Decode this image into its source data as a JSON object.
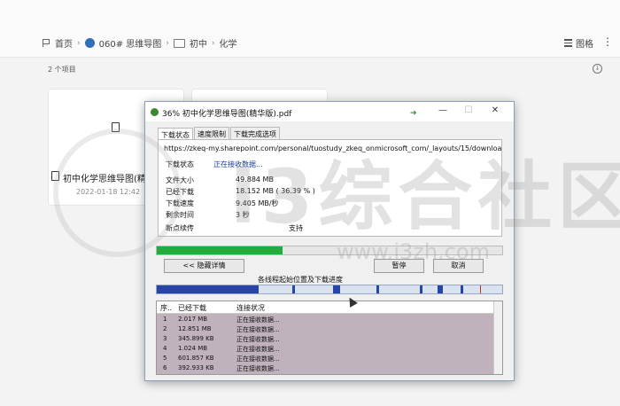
{
  "breadcrumb": {
    "home": "首页",
    "site": "060# 思维导图",
    "folder": "初中",
    "current": "化学"
  },
  "view": {
    "label": "图格"
  },
  "items_count": "2 个项目",
  "card": {
    "name": "初中化学思维导图(精华版).pdf",
    "date": "2022-01-18 12:42"
  },
  "watermark": {
    "text": "i3综合社区",
    "url": "www.i3zh.com"
  },
  "dialog": {
    "title": "36% 初中化学思维导图(精华版).pdf",
    "tabs": [
      "下载状态",
      "速度限制",
      "下载完成选项"
    ],
    "url": "https://zkeq-my.sharepoint.com/personal/tuostudy_zkeq_onmicrosoft_com/_layouts/15/download.aspx",
    "status_label": "下载状态",
    "status_value": "正在接收数据...",
    "fields": [
      {
        "label": "文件大小",
        "value": "49.884  MB"
      },
      {
        "label": "已经下载",
        "value": "18.152  MB  ( 36.39 % )"
      },
      {
        "label": "下载速度",
        "value": "9.405  MB/秒"
      },
      {
        "label": "剩余时间",
        "value": "3 秒"
      },
      {
        "label": "断点续传",
        "value": "支持"
      }
    ],
    "progress": 0.3639,
    "hide_details_button": "<< 隐藏详情",
    "pause_button": "暂停",
    "cancel_button": "取消",
    "thread_caption": "各线程起始位置及下载进度",
    "list": {
      "headers": [
        "序..",
        "已经下载",
        "连接状况"
      ],
      "rows": [
        {
          "no": "1",
          "downloaded": "2.017 MB",
          "state": "正在接收数据..."
        },
        {
          "no": "2",
          "downloaded": "12.851 MB",
          "state": "正在接收数据..."
        },
        {
          "no": "3",
          "downloaded": "345.899 KB",
          "state": "正在接收数据..."
        },
        {
          "no": "4",
          "downloaded": "1.024 MB",
          "state": "正在接收数据..."
        },
        {
          "no": "5",
          "downloaded": "601.857 KB",
          "state": "正在接收数据..."
        },
        {
          "no": "6",
          "downloaded": "392.933 KB",
          "state": "正在接收数据..."
        }
      ]
    }
  }
}
